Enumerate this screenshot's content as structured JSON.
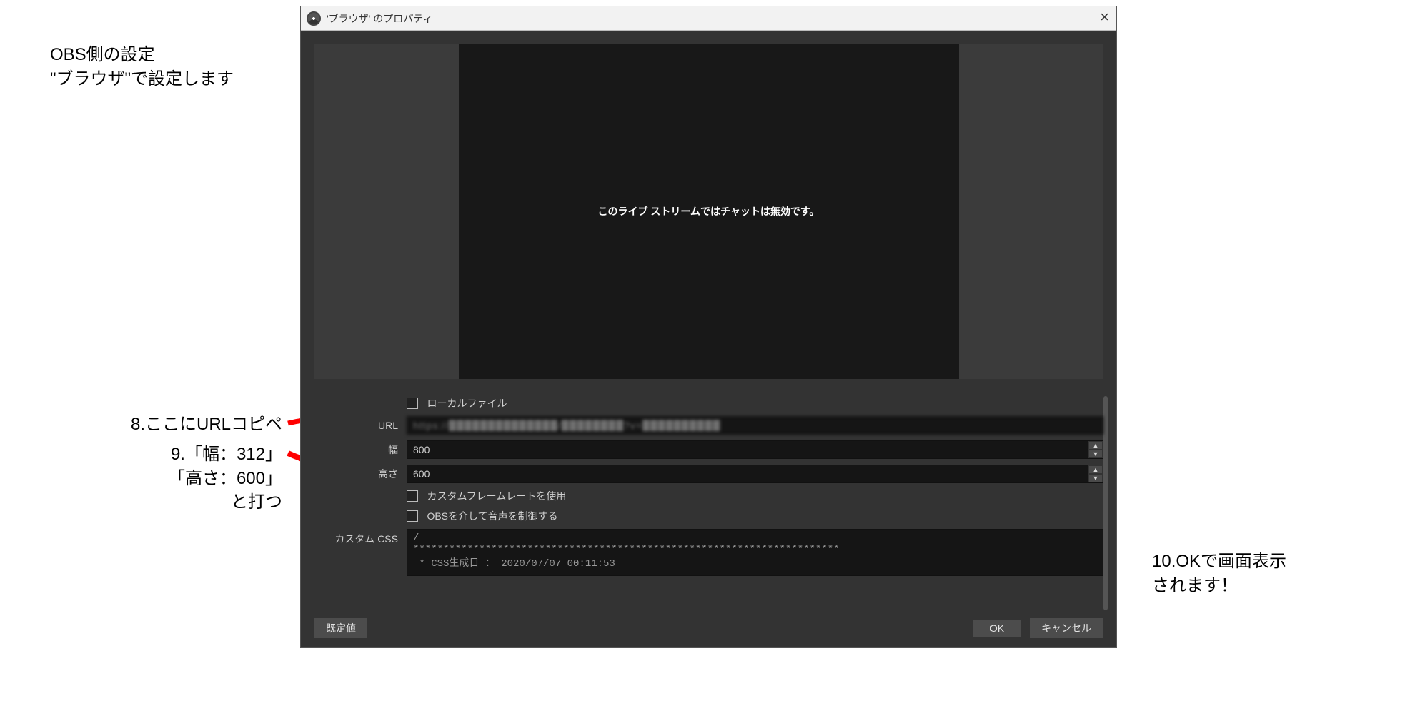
{
  "dialog": {
    "title": "'ブラウザ' のプロパティ",
    "preview_text": "このライブ ストリームではチャットは無効です。",
    "local_file_label": "ローカルファイル",
    "url_label": "URL",
    "url_value": "https://██████████████/████████?v=██████████",
    "width_label": "幅",
    "width_value": "800",
    "height_label": "高さ",
    "height_value": "600",
    "custom_fps_label": "カスタムフレームレートを使用",
    "obs_audio_label": "OBSを介して音声を制御する",
    "custom_css_label": "カスタム CSS",
    "custom_css_value": "/\n***********************************************************************\n * CSS生成日 ： 2020/07/07 00:11:53",
    "default_btn": "既定値",
    "ok_btn": "OK",
    "cancel_btn": "キャンセル"
  },
  "annotations": {
    "title_line1": "OBS側の設定",
    "title_line2": "\"ブラウザ\"で設定します",
    "step8": "8.ここにURLコピペ",
    "step9_line1": "9.「幅：312」",
    "step9_line2": "「高さ：600」",
    "step9_line3": "と打つ",
    "step10_line1": "10.OKで画面表示",
    "step10_line2": "されます！"
  }
}
